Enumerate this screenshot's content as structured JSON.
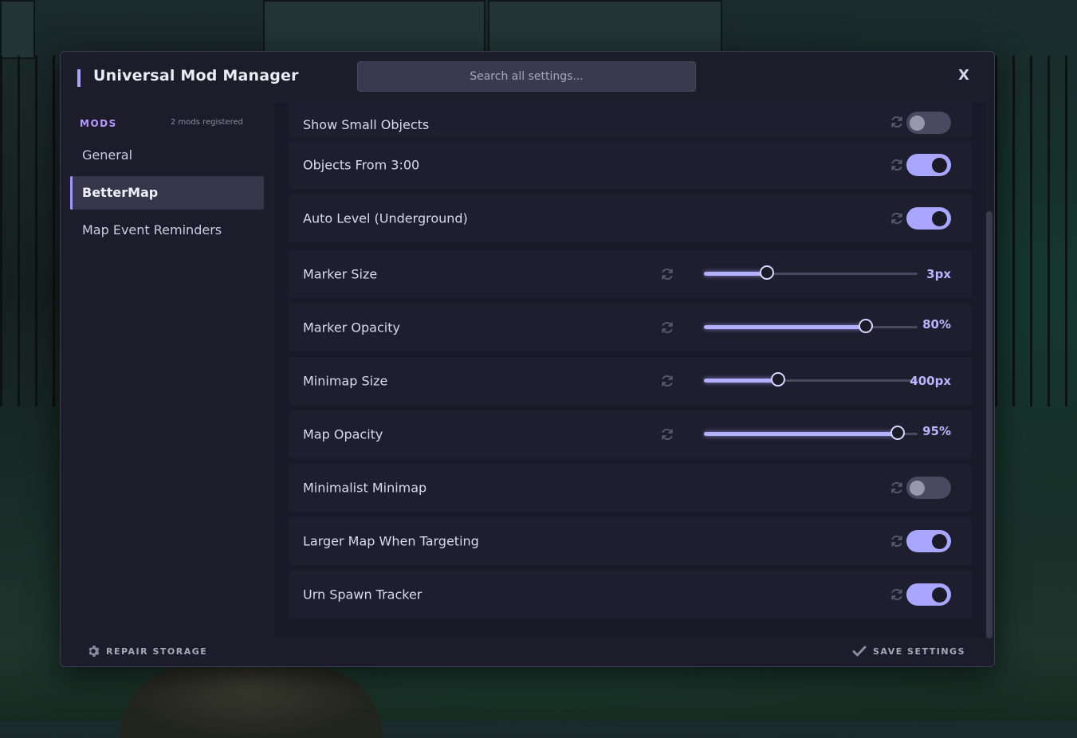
{
  "header": {
    "title": "Universal Mod Manager",
    "search_placeholder": "Search all settings...",
    "close_label": "X"
  },
  "sidebar": {
    "section_label": "MODS",
    "mods_count": "2 mods registered",
    "items": [
      {
        "label": "General",
        "active": false
      },
      {
        "label": "BetterMap",
        "active": true
      },
      {
        "label": "Map Event Reminders",
        "active": false
      }
    ]
  },
  "settings": [
    {
      "label": "Show Small Objects",
      "type": "toggle",
      "on": false
    },
    {
      "label": "Objects From 3:00",
      "type": "toggle",
      "on": true
    },
    {
      "label": "Auto Level (Underground)",
      "type": "toggle",
      "on": true
    },
    {
      "label": "Marker Size",
      "type": "slider",
      "value_text": "3px",
      "fill": 0.3
    },
    {
      "label": "Marker Opacity",
      "type": "slider",
      "value_text": "80%",
      "fill": 0.76
    },
    {
      "label": "Minimap Size",
      "type": "slider",
      "value_text": "400px",
      "fill": 0.35
    },
    {
      "label": "Map Opacity",
      "type": "slider",
      "value_text": "95%",
      "fill": 0.91
    },
    {
      "label": "Minimalist Minimap",
      "type": "toggle",
      "on": false
    },
    {
      "label": "Larger Map When Targeting",
      "type": "toggle",
      "on": true
    },
    {
      "label": "Urn Spawn Tracker",
      "type": "toggle",
      "on": true
    }
  ],
  "footer": {
    "repair_label": "REPAIR STORAGE",
    "save_label": "SAVE SETTINGS"
  },
  "icons": {
    "reset": "reset-icon",
    "repair": "gear-icon",
    "save": "checkmark-icon"
  },
  "colors": {
    "accent": "#a8a6ff",
    "panel": "#1d1c2b",
    "section_label": "#b59bff"
  }
}
